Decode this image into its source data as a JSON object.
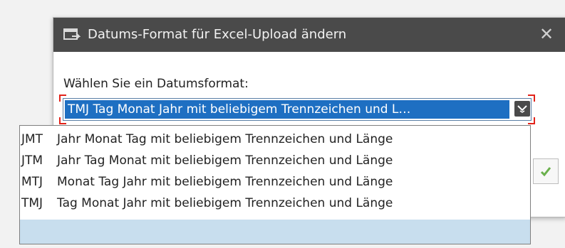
{
  "dialog": {
    "title": "Datums-Format für Excel-Upload ändern",
    "close_symbol": "✕",
    "prompt": "Wählen Sie ein Datumsformat:",
    "selected_value": "TMJ Tag Monat Jahr mit beliebigem Trennzeichen und L…",
    "title_icon": "dialog-window-icon",
    "dropdown_icon": "chevron-down-icon",
    "ok_icon": "checkmark-icon"
  },
  "listbox": {
    "items": [
      {
        "code": "JMT",
        "label": "Jahr Monat Tag mit beliebigem Trennzeichen und Länge"
      },
      {
        "code": "JTM",
        "label": "Jahr Tag Monat mit beliebigem Trennzeichen und Länge"
      },
      {
        "code": "MTJ",
        "label": "Monat Tag Jahr mit beliebigem Trennzeichen und Länge"
      },
      {
        "code": "TMJ",
        "label": "Tag Monat Jahr mit beliebigem Trennzeichen und Länge"
      }
    ]
  },
  "colors": {
    "titlebar": "#4a4a4a",
    "selection": "#1e6fc2",
    "focus_marker": "#e2231a",
    "list_highlight": "#c8deee",
    "ok_check": "#6ab04c"
  }
}
